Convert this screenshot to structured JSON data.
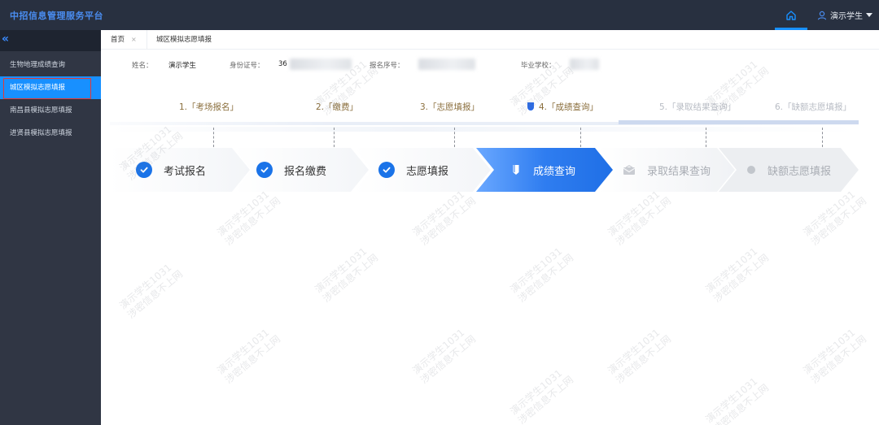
{
  "app": {
    "title": "中招信息管理服务平台",
    "user_name": "演示学生"
  },
  "sidebar": {
    "collapse_glyph": "«",
    "items": [
      {
        "label": "生物地理成绩查询",
        "active": false
      },
      {
        "label": "城区模拟志愿填报",
        "active": true
      },
      {
        "label": "南昌县模拟志愿填报",
        "active": false
      },
      {
        "label": "进贤县模拟志愿填报",
        "active": false
      }
    ]
  },
  "tabs": {
    "home": "首页",
    "home_close": "×",
    "current": "城区模拟志愿填报"
  },
  "info": {
    "name_label": "姓名：",
    "name_value": "演示学生",
    "id_label": "身份证号：",
    "id_value": "36",
    "reg_label": "报名序号：",
    "school_label": "毕业学校："
  },
  "steps_top": [
    {
      "label": "1.「考场报名」"
    },
    {
      "label": "2.「缴费」"
    },
    {
      "label": "3.「志愿填报」"
    },
    {
      "label": "4.「成绩查询」"
    },
    {
      "label": "5.「录取结果查询」"
    },
    {
      "label": "6.「缺额志愿填报」"
    }
  ],
  "steps_flow": [
    {
      "label": "考试报名",
      "state": "done"
    },
    {
      "label": "报名缴费",
      "state": "done"
    },
    {
      "label": "志愿填报",
      "state": "done"
    },
    {
      "label": "成绩查询",
      "state": "current"
    },
    {
      "label": "录取结果查询",
      "state": "future"
    },
    {
      "label": "缺额志愿填报",
      "state": "future"
    }
  ],
  "watermark": {
    "text": "演示学生1031\n涉密信息不上网"
  },
  "colors": {
    "topbar": "#283040",
    "sidebar": "#303644",
    "accent": "#1890ff",
    "done_check": "#1a73e8",
    "active_outline": "#e53935"
  }
}
